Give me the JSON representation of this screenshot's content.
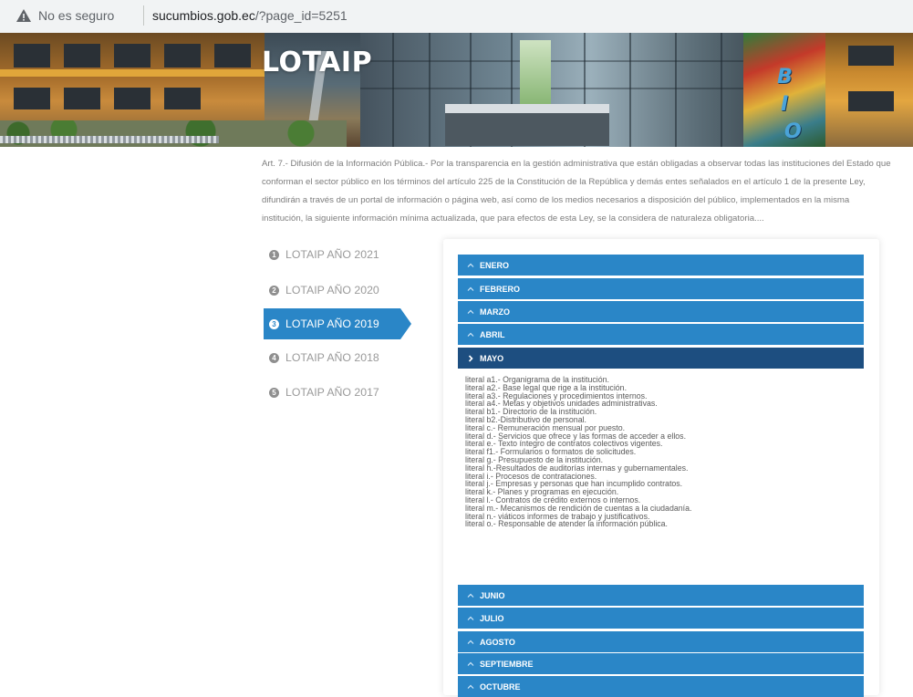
{
  "browser": {
    "security_status": "No es seguro",
    "url_host": "sucumbios.gob.ec",
    "url_path": "/?page_id=5251"
  },
  "hero": {
    "title": "LOTAIP",
    "mural_letters": [
      "B",
      "I",
      "O"
    ]
  },
  "intro": {
    "text": "Art. 7.- Difusión de la Información Pública.- Por la transparencia en la gestión administrativa que están obligadas a observar todas las instituciones del Estado que conforman el sector público en los términos del artículo 225 de la Constitución de la República y demás entes señalados en el artículo 1 de la presente Ley, difundirán a través de un portal de información o página web, así como de los medios necesarios a disposición del público, implementados en la misma institución, la siguiente información mínima actualizada, que para efectos de esta Ley, se la considera de naturaleza obligatoria...."
  },
  "years": [
    {
      "num": "1",
      "label": "LOTAIP AÑO 2021",
      "active": false
    },
    {
      "num": "2",
      "label": "LOTAIP AÑO 2020",
      "active": false
    },
    {
      "num": "3",
      "label": "LOTAIP AÑO 2019",
      "active": true
    },
    {
      "num": "4",
      "label": "LOTAIP AÑO 2018",
      "active": false
    },
    {
      "num": "5",
      "label": "LOTAIP AÑO 2017",
      "active": false
    }
  ],
  "months_before": [
    "ENERO",
    "FEBRERO",
    "MARZO",
    "ABRIL"
  ],
  "open_month": "MAYO",
  "months_after": [
    "JUNIO",
    "JULIO",
    "AGOSTO",
    "SEPTIEMBRE",
    "OCTUBRE"
  ],
  "literals": [
    "literal a1.- Organigrama de la institución.",
    "literal a2.- Base legal que rige a la institución.",
    "literal a3.- Regulaciones y procedimientos internos.",
    "literal a4.- Metas y objetivos unidades administrativas.",
    "literal b1.- Directorio de la institución.",
    "literal b2.-Distributivo de personal.",
    "literal c.- Remuneración  mensual por puesto.",
    "literal d.- Servicios que ofrece y las formas de acceder a ellos.",
    "literal e.- Texto íntegro de contratos colectivos vigentes.",
    "literal f1.- Formularios o formatos de solicitudes.",
    "literal g.- Presupuesto de la institución.",
    "literal h.-Resultados de auditorías internas y gubernamentales.",
    "literal i.- Procesos de contrataciones.",
    "literal j.- Empresas y personas que han incumplido contratos.",
    "literal k.- Planes y programas en ejecución.",
    "literal l.- Contratos de crédito externos o internos.",
    "literal m.- Mecanismos de rendición de cuentas a la ciudadanía.",
    "literal n.- viáticos informes de trabajo y justificativos.",
    "literal o.- Responsable de atender la información pública."
  ],
  "colors": {
    "accent": "#2a86c7",
    "accent_dark": "#1d4e80",
    "text_muted": "#7d7d7d"
  }
}
